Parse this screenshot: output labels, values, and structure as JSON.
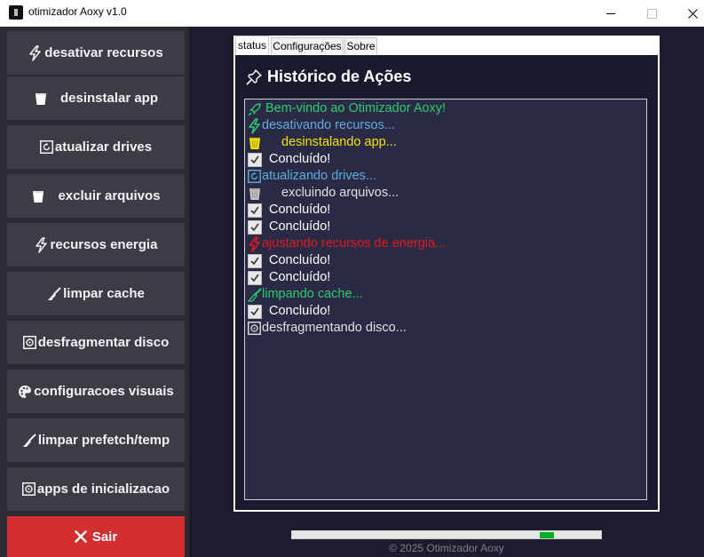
{
  "window": {
    "title": "otimizador Aoxy v1.0",
    "icons": [
      "app-icon",
      "minimize-icon",
      "maximize-icon",
      "close-icon"
    ]
  },
  "sidebar": {
    "buttons": [
      {
        "label": "desativar recursos",
        "icon": "lightning-icon"
      },
      {
        "label": "desinstalar app",
        "icon": "trash-icon"
      },
      {
        "label": "atualizar drives",
        "icon": "refresh-icon"
      },
      {
        "label": "excluir arquivos",
        "icon": "trash-icon"
      },
      {
        "label": "recursos energia",
        "icon": "lightning-icon"
      },
      {
        "label": "limpar cache",
        "icon": "broom-icon"
      },
      {
        "label": "desfragmentar disco",
        "icon": "disk-icon"
      },
      {
        "label": "configuracoes visuais",
        "icon": "palette-icon"
      },
      {
        "label": "limpar prefetch/temp",
        "icon": "broom-icon"
      },
      {
        "label": "apps de inicializacao",
        "icon": "disk-icon"
      }
    ],
    "exit_label": "Sair",
    "exit_icon": "x-icon"
  },
  "tabs": [
    {
      "label": "status",
      "active": true
    },
    {
      "label": "Configurações",
      "active": false
    },
    {
      "label": "Sobre",
      "active": false
    }
  ],
  "history": {
    "title": "Histórico de Ações",
    "title_icon": "pin-icon",
    "lines": [
      {
        "text": "Bem-vindo ao Otimizador Aoxy!",
        "icon": "rocket-icon",
        "color": "#2ecc71"
      },
      {
        "text": "desativando recursos...",
        "icon": "lightning-icon",
        "color": "#5dade2"
      },
      {
        "text": "desinstalando app...",
        "icon": "trash-icon",
        "color": "#f1e40f"
      },
      {
        "text": "Concluído!",
        "icon": "check-icon",
        "color": "#ffffff"
      },
      {
        "text": "atualizando drives...",
        "icon": "refresh-icon",
        "color": "#5dade2"
      },
      {
        "text": "excluindo arquivos...",
        "icon": "trash-icon",
        "color": "#e0e0e0"
      },
      {
        "text": "Concluído!",
        "icon": "check-icon",
        "color": "#ffffff"
      },
      {
        "text": "Concluído!",
        "icon": "check-icon",
        "color": "#ffffff"
      },
      {
        "text": "ajustando recursos de energia...",
        "icon": "lightning-icon",
        "color": "#e3191f"
      },
      {
        "text": "Concluído!",
        "icon": "check-icon",
        "color": "#ffffff"
      },
      {
        "text": "Concluído!",
        "icon": "check-icon",
        "color": "#ffffff"
      },
      {
        "text": "limpando cache...",
        "icon": "broom-icon",
        "color": "#2ecc71"
      },
      {
        "text": "Concluído!",
        "icon": "check-icon",
        "color": "#ffffff"
      },
      {
        "text": "desfragmentando disco...",
        "icon": "disk-icon",
        "color": "#e0e0e0"
      }
    ]
  },
  "progress": {
    "indicator_position": 0.84
  },
  "footer": {
    "copyright": "© 2025 Otimizador Aoxy"
  },
  "colors": {
    "sidebar_bg": "#2b2b33",
    "button_bg": "#3d3c45",
    "exit_bg": "#d32f2f",
    "main_bg": "#1c1c2e",
    "log_bg": "#2a2a45",
    "progress_indicator": "#06b025"
  }
}
